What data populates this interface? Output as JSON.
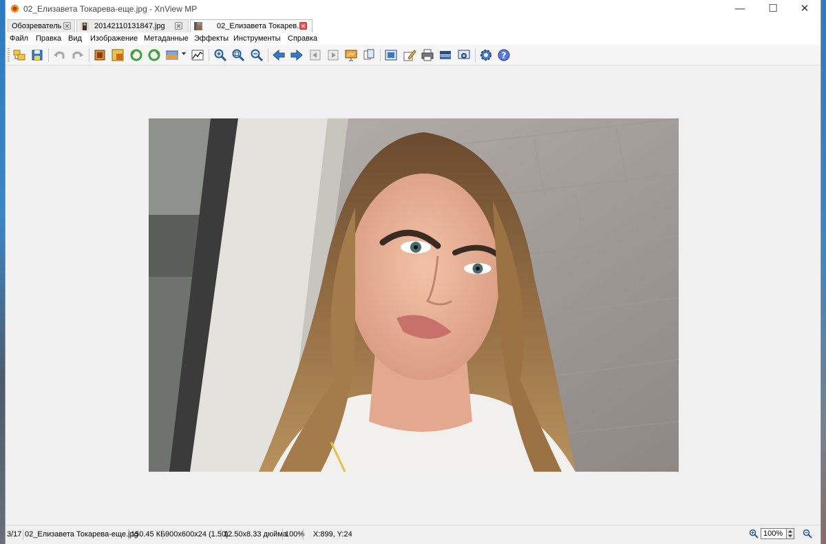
{
  "window": {
    "title": "02_Елизавета Токарева-еще.jpg - XnView MP"
  },
  "tabs": [
    {
      "label": "Обозреватель"
    },
    {
      "label": "20142110131847.jpg"
    },
    {
      "label": "02_Елизавета Токарев..."
    }
  ],
  "menu": [
    "Файл",
    "Правка",
    "Вид",
    "Изображение",
    "Метаданные",
    "Эффекты",
    "Инструменты",
    "Справка"
  ],
  "toolbar_icons": [
    "browser-icon",
    "save-icon",
    "undo-icon",
    "redo-icon",
    "crop-icon",
    "resize-icon",
    "rotate-left-icon",
    "rotate-right-icon",
    "adjust-icon",
    "histogram-icon",
    "zoom-in-icon",
    "zoom-fit-icon",
    "zoom-out-icon",
    "previous-icon",
    "next-icon",
    "first-icon",
    "last-icon",
    "slideshow-icon",
    "copy-icon",
    "fullscreen-icon",
    "edit-icon",
    "print-icon",
    "scanner-icon",
    "screen-capture-icon",
    "settings-icon",
    "help-icon"
  ],
  "image": {
    "description_icon": "photo-portrait"
  },
  "status": {
    "position": "3/17",
    "filename": "02_Елизавета Токарева-еще.jpg",
    "filesize": "150.45 КБ",
    "dimensions": "900x600x24 (1.50)",
    "print_size": "12.50x8.33 дюйма",
    "zoom_percent": "100%",
    "coords": "X:899, Y:24",
    "zoom_value": "100%"
  },
  "colors": {
    "accent": "#2d7bc0",
    "close_red": "#e2574c"
  }
}
